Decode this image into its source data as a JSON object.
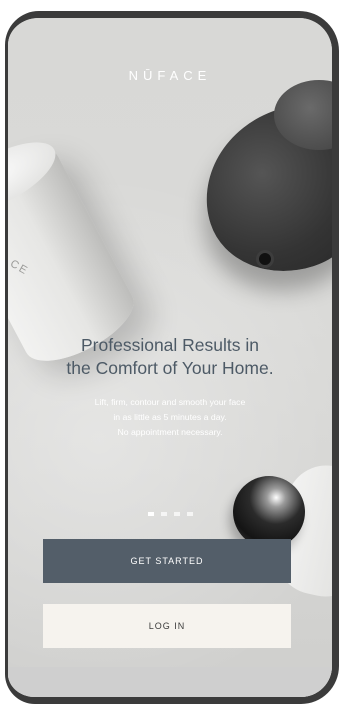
{
  "brand": {
    "logo_text": "NŪFACE"
  },
  "hero": {
    "headline_line1": "Professional Results in",
    "headline_line2": "the Comfort of Your Home.",
    "subtext_line1": "Lift, firm, contour and smooth your face",
    "subtext_line2": "in as little as 5 minutes a day.",
    "subtext_line3": "No appointment necessary.",
    "product_mark": "CE"
  },
  "pager": {
    "total": 4,
    "active_index": 0
  },
  "actions": {
    "get_started_label": "GET STARTED",
    "login_label": "LOG IN"
  },
  "colors": {
    "headline": "#4d5a66",
    "primary_button": "#535e69",
    "secondary_button": "#f6f3ee"
  }
}
